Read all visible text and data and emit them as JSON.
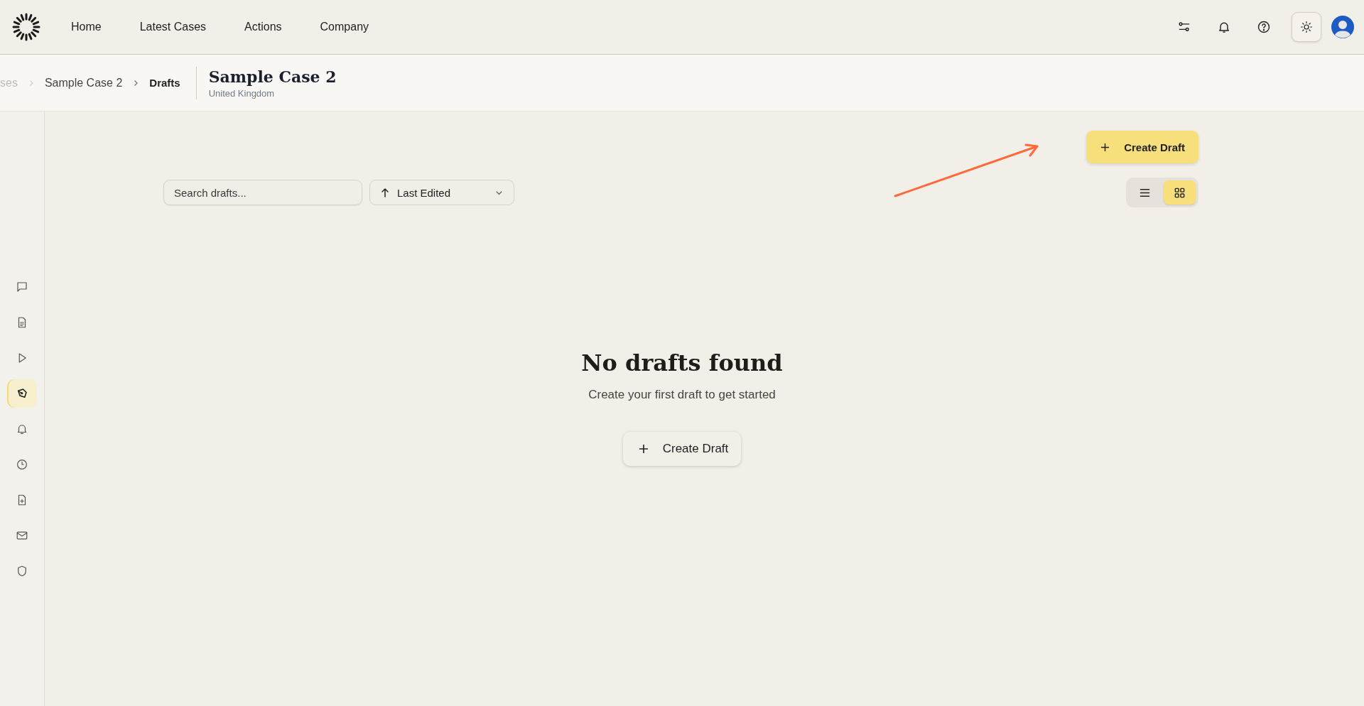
{
  "top_nav": {
    "items": [
      {
        "label": "Home"
      },
      {
        "label": "Latest Cases"
      },
      {
        "label": "Actions"
      },
      {
        "label": "Company"
      }
    ]
  },
  "breadcrumb": {
    "items": [
      {
        "label": "ses",
        "faded": true
      },
      {
        "label": "Sample Case 2",
        "faded": false
      },
      {
        "label": "Drafts",
        "faded": false
      }
    ]
  },
  "case_header": {
    "title": "Sample Case 2",
    "subtitle": "United Kingdom"
  },
  "sidebar": {
    "items": [
      {
        "kind": "chat",
        "selected": false
      },
      {
        "kind": "document",
        "selected": false
      },
      {
        "kind": "play",
        "selected": false
      },
      {
        "kind": "pen",
        "selected": true
      },
      {
        "kind": "bell",
        "selected": false
      },
      {
        "kind": "clock",
        "selected": false
      },
      {
        "kind": "file-plus",
        "selected": false
      },
      {
        "kind": "mail",
        "selected": false
      },
      {
        "kind": "shield",
        "selected": false
      }
    ]
  },
  "toolbar": {
    "create_button": "Create Draft",
    "search": {
      "placeholder": "Search drafts..."
    },
    "sort": {
      "value": "Last Edited"
    },
    "view_options": [
      {
        "kind": "list",
        "selected": false
      },
      {
        "kind": "grid",
        "selected": true
      }
    ]
  },
  "empty_state": {
    "title": "No drafts found",
    "message": "Create your first draft to get started",
    "button": "Create Draft"
  }
}
